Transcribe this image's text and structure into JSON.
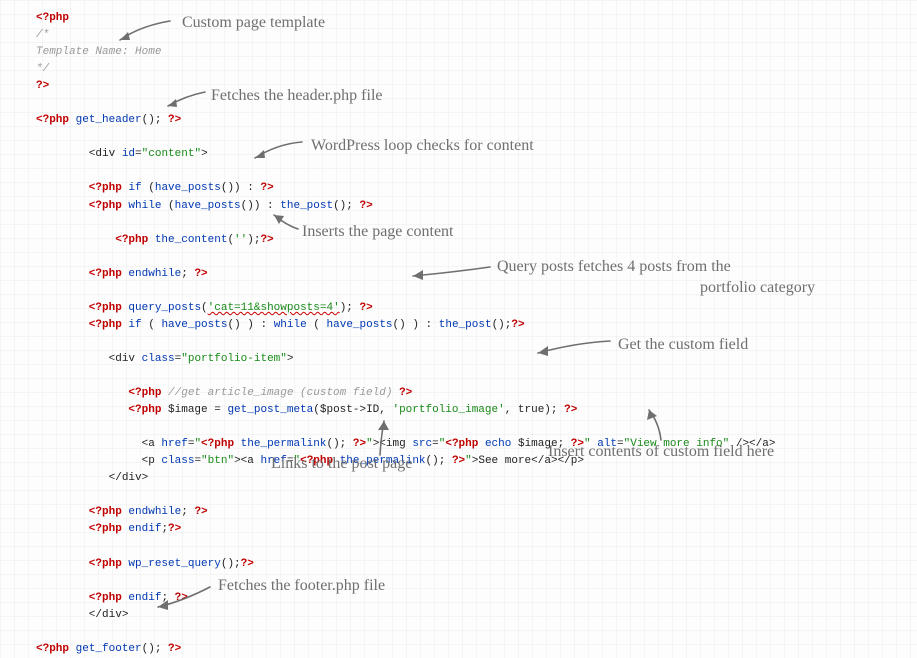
{
  "code": {
    "l1": "<?php",
    "l2": "/*",
    "l3": "Template Name: Home",
    "l4": "*/",
    "l5": "?>",
    "l6a": "<?php",
    "l6b": " get_header",
    "l6c": "(); ",
    "l6d": "?>",
    "l7a": "        <div ",
    "l7b": "id",
    "l7c": "=",
    "l7d": "\"content\"",
    "l7e": ">",
    "l8a": "        <?php",
    "l8b": " if",
    "l8c": " (",
    "l8d": "have_posts",
    "l8e": "()) : ",
    "l8f": "?>",
    "l9a": "        <?php",
    "l9b": " while",
    "l9c": " (",
    "l9d": "have_posts",
    "l9e": "()) : ",
    "l9f": "the_post",
    "l9g": "(); ",
    "l9h": "?>",
    "l10a": "            <?php",
    "l10b": " the_content",
    "l10c": "(",
    "l10d": "''",
    "l10e": ");",
    "l10f": "?>",
    "l11a": "        <?php",
    "l11b": " endwhile",
    "l11c": "; ",
    "l11d": "?>",
    "l12a": "        <?php",
    "l12b": " query_posts",
    "l12c": "(",
    "l12d": "'cat=11&showposts=4'",
    "l12e": "); ",
    "l12f": "?>",
    "l13a": "        <?php",
    "l13b": " if",
    "l13c": " ( ",
    "l13d": "have_posts",
    "l13e": "() ) : ",
    "l13f": "while",
    "l13g": " ( ",
    "l13h": "have_posts",
    "l13i": "() ) : ",
    "l13j": "the_post",
    "l13k": "();",
    "l13l": "?>",
    "l14a": "           <div ",
    "l14b": "class",
    "l14c": "=",
    "l14d": "\"portfolio-item\"",
    "l14e": ">",
    "l15a": "              <?php",
    "l15b": " //get article_image (custom field) ",
    "l15c": "?>",
    "l16a": "              <?php",
    "l16b": " $image = ",
    "l16c": "get_post_meta",
    "l16d": "($post->ID, ",
    "l16e": "'portfolio_image'",
    "l16f": ", true); ",
    "l16g": "?>",
    "l17a": "                <a ",
    "l17b": "href",
    "l17c": "=",
    "l17d": "\"",
    "l17e": "<?php",
    "l17f": " the_permalink",
    "l17g": "(); ",
    "l17h": "?>",
    "l17i": "\"",
    "l17j": "><img ",
    "l17k": "src",
    "l17l": "=",
    "l17m": "\"",
    "l17n": "<?php",
    "l17o": " echo",
    "l17p": " $image; ",
    "l17q": "?>",
    "l17r": "\"",
    "l17s": " alt",
    "l17t": "=",
    "l17u": "\"View more info\"",
    "l17v": " /></a>",
    "l18a": "                <p ",
    "l18b": "class",
    "l18c": "=",
    "l18d": "\"btn\"",
    "l18e": "><a ",
    "l18f": "href",
    "l18g": "=",
    "l18h": "\"",
    "l18i": "<?php",
    "l18j": " the_permalink",
    "l18k": "(); ",
    "l18l": "?>",
    "l18m": "\"",
    "l18n": ">See more</a></p>",
    "l19": "           </div>",
    "l20a": "        <?php",
    "l20b": " endwhile",
    "l20c": "; ",
    "l20d": "?>",
    "l21a": "        <?php",
    "l21b": " endif",
    "l21c": ";",
    "l21d": "?>",
    "l22a": "        <?php",
    "l22b": " wp_reset_query",
    "l22c": "();",
    "l22d": "?>",
    "l23a": "        <?php",
    "l23b": " endif",
    "l23c": "; ",
    "l23d": "?>",
    "l24": "        </div>",
    "l25a": "<?php",
    "l25b": " get_footer",
    "l25c": "(); ",
    "l25d": "?>"
  },
  "annotations": {
    "a1": "Custom page template",
    "a2": "Fetches the header.php file",
    "a3": "WordPress loop checks for content",
    "a4": "Inserts the page content",
    "a5a": "Query posts fetches 4 posts from the",
    "a5b": "portfolio category",
    "a6": "Get the custom field",
    "a7": "Links to the post page",
    "a8": "Insert contents of custom field here",
    "a9": "Fetches the footer.php file"
  }
}
